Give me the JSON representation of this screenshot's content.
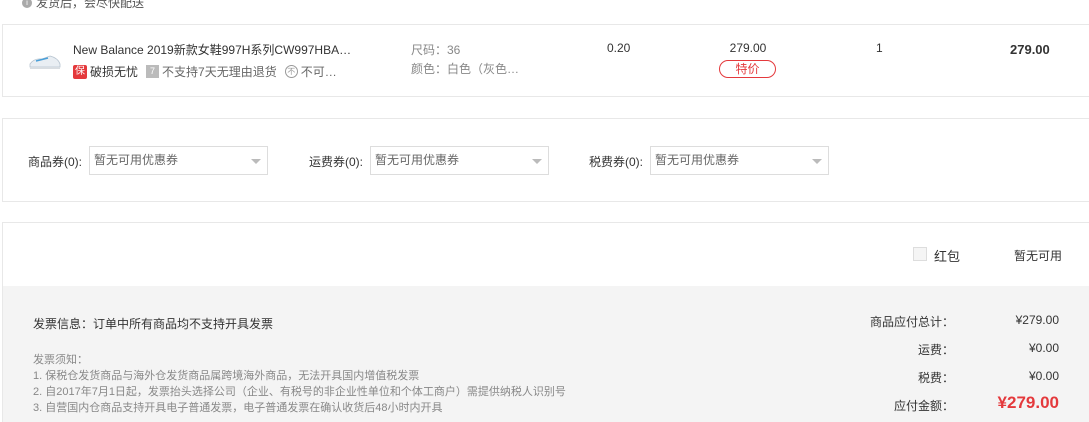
{
  "ship_note": "发货后，会尽快配送",
  "product": {
    "name": "New Balance 2019新款女鞋997H系列CW997HBA…",
    "tag_baoxian": "保",
    "tag_baoxian_text": "破损无忧",
    "tag_return_icon": "7",
    "tag_return_text": "不支持7天无理由退货",
    "tag_other_icon": "不",
    "tag_other_text": "不可…",
    "size": "尺码：36",
    "color": "颜色：白色（灰色…",
    "weight": "0.20",
    "price": "279.00",
    "special_label": "特价",
    "quantity": "1",
    "subtotal": "279.00"
  },
  "coupons": {
    "goods_label": "商品券(0):",
    "goods_value": "暂无可用优惠券",
    "shipping_label": "运费券(0):",
    "shipping_value": "暂无可用优惠券",
    "tax_label": "税费券(0):",
    "tax_value": "暂无可用优惠券"
  },
  "hongbao": {
    "label": "红包",
    "status": "暂无可用"
  },
  "invoice": {
    "info": "发票信息：订单中所有商品均不支持开具发票",
    "notes_title": "发票须知：",
    "note_1": "1. 保税仓发货商品与海外仓发货商品属跨境海外商品，无法开具国内增值税发票",
    "note_2": "2. 自2017年7月1日起，发票抬头选择公司（企业、有税号的非企业性单位和个体工商户）需提供纳税人识别号",
    "note_3": "3. 自营国内仓商品支持开具电子普通发票，电子普通发票在确认收货后48小时内开具"
  },
  "summary": {
    "goods_total_label": "商品应付总计：",
    "goods_total_value": "¥279.00",
    "shipping_label": "运费：",
    "shipping_value": "¥0.00",
    "tax_label": "税费：",
    "tax_value": "¥0.00",
    "pay_label": "应付金额：",
    "pay_value": "¥279.00"
  },
  "colors": {
    "accent_red": "#e4393c",
    "summary_bg": "#f4f4f4"
  }
}
